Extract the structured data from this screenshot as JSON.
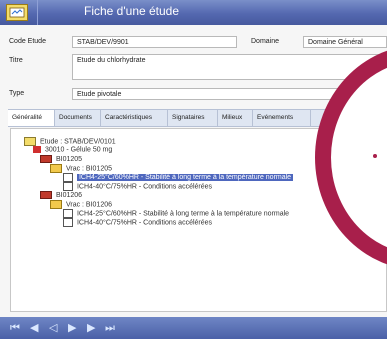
{
  "window": {
    "title": "Fiche d'une étude"
  },
  "form": {
    "code_label": "Code Etude",
    "code_value": "STAB/DEV/9901",
    "domain_label": "Domaine",
    "domain_value": "Domaine Général",
    "title_label": "Titre",
    "title_value": "Etude du chlorhydrate",
    "type_label": "Type",
    "type_value": "Etude pivotale"
  },
  "tabs": [
    {
      "label": "Généralité"
    },
    {
      "label": "Documents"
    },
    {
      "label": "Caractéristiques"
    },
    {
      "label": "Signataires"
    },
    {
      "label": "Milieux"
    },
    {
      "label": "Evénements"
    }
  ],
  "tree": {
    "items": [
      {
        "label": "Etude : STAB/DEV/0101"
      },
      {
        "label": "30010 - Gélule 50 mg"
      },
      {
        "label": "BI01205"
      },
      {
        "label": "Vrac : BI01205"
      },
      {
        "label": "ICH4-25°C/60%HR - Stabilité à long terme à la température normale"
      },
      {
        "label": "ICH4-40°C/75%HR - Conditions accélérées"
      },
      {
        "label": "BI01206"
      },
      {
        "label": "Vrac : BI01206"
      },
      {
        "label": "ICH4-25°C/60%HR - Stabilité à long terme à la température normale"
      },
      {
        "label": "ICH4-40°C/75%HR - Conditions accélérées"
      }
    ]
  },
  "navigation": {
    "first": "⏮",
    "prev_page": "◀",
    "prev": "◁",
    "next": "▶",
    "next_page": "▶",
    "last": "⏭"
  }
}
